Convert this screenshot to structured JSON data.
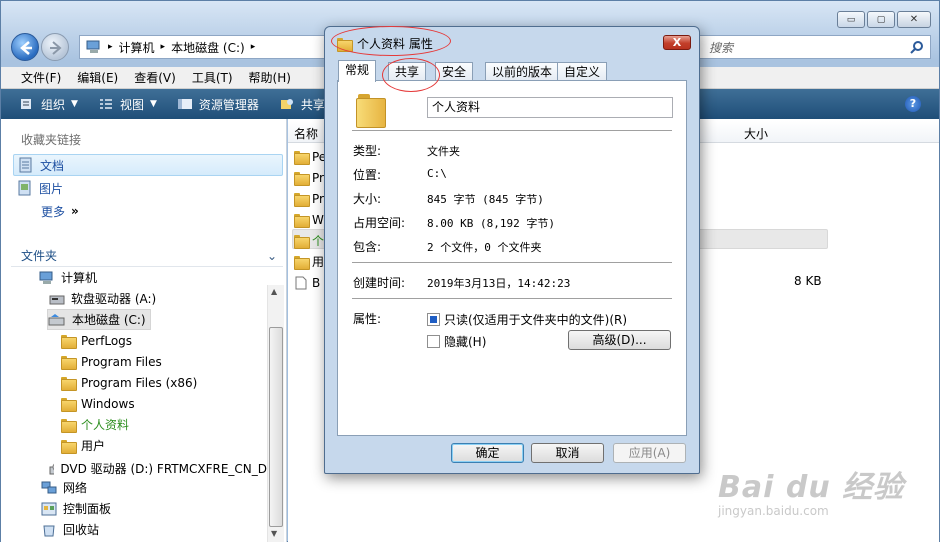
{
  "window_controls": {
    "minimize": "▭",
    "maximize": "▢",
    "close": "✕"
  },
  "address": {
    "path": [
      "计算机",
      "本地磁盘 (C:)"
    ],
    "separator": "▸"
  },
  "search": {
    "placeholder": "搜索"
  },
  "menu": [
    "文件(F)",
    "编辑(E)",
    "查看(V)",
    "工具(T)",
    "帮助(H)"
  ],
  "toolbar": {
    "organize": "组织",
    "views": "视图",
    "explorer": "资源管理器",
    "share": "共享",
    "help": "?"
  },
  "favorites": {
    "title": "收藏夹链接",
    "items": [
      "文档",
      "图片"
    ],
    "more": "更多",
    "more_glyph": "»"
  },
  "folders": {
    "title": "文件夹"
  },
  "tree": {
    "computer": "计算机",
    "floppy": "软盘驱动器 (A:)",
    "local_disk": "本地磁盘 (C:)",
    "children": [
      "PerfLogs",
      "Program Files",
      "Program Files (x86)",
      "Windows",
      "个人资料",
      "用户"
    ],
    "dvd": "DVD 驱动器 (D:) FRTMCXFRE_CN_D",
    "network": "网络",
    "control_panel": "控制面板",
    "recycle": "回收站"
  },
  "list": {
    "col_name": "名称",
    "col_size": "大小",
    "rows": [
      "Pe",
      "Pr",
      "Pr",
      "W",
      "个",
      "用",
      "B"
    ],
    "last_size": "8 KB"
  },
  "dialog": {
    "title": "个人资料 属性",
    "close": "X",
    "tabs": [
      "常规",
      "共享",
      "安全",
      "以前的版本",
      "自定义"
    ],
    "folder_name": "个人资料",
    "type_label": "类型:",
    "type_value": "文件夹",
    "location_label": "位置:",
    "location_value": "C:\\",
    "size_label": "大小:",
    "size_value": "845 字节 (845 字节)",
    "disk_label": "占用空间:",
    "disk_value": "8.00 KB (8,192 字节)",
    "contains_label": "包含:",
    "contains_value": "2 个文件，0 个文件夹",
    "created_label": "创建时间:",
    "created_value": "2019年3月13日，14:42:23",
    "attr_label": "属性:",
    "readonly": "只读(仅适用于文件夹中的文件)(R)",
    "hidden": "隐藏(H)",
    "advanced": "高级(D)...",
    "ok": "确定",
    "cancel": "取消",
    "apply": "应用(A)"
  },
  "watermark": {
    "logo": "Bai du 经验",
    "url": "jingyan.baidu.com"
  }
}
